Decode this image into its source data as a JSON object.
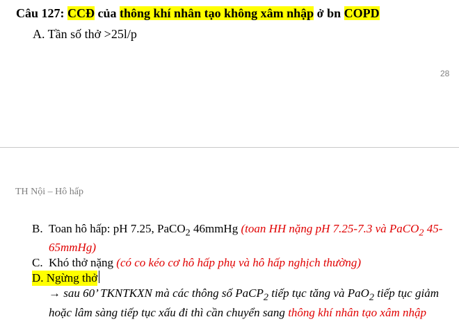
{
  "slide1": {
    "question": {
      "prefix": "Câu 127:",
      "hl1": "CCĐ",
      "mid1": "của",
      "hl2": "thông khí nhân tạo không xâm nhập",
      "mid2": "ở bn",
      "hl3": "COPD"
    },
    "option_a": "A. Tần số thở >25l/p",
    "page_number": "28"
  },
  "slide2": {
    "section_label": "TH Nội – Hô hấp",
    "options": {
      "b": {
        "letter": "B.",
        "text_pre": "Toan hô hấp: pH 7.25, PaCO",
        "sub": "2",
        "text_post": " 46mmHg",
        "note_pre": "(toan HH nặng pH 7.25-7.3 và PaCO",
        "note_sub": "2",
        "note_post": " 45-65mmHg)"
      },
      "c": {
        "letter": "C.",
        "text": "Khó thở nặng",
        "note": "(có co kéo cơ hô hấp phụ và hô hấp nghịch thường)"
      },
      "d": {
        "letter": "D.",
        "text": "Ngừng thở"
      }
    },
    "explanation": {
      "part1": "→ sau 60’ TKNTKXN mà các thông số PaCP",
      "sub1": "2",
      "part2": " tiếp tục tăng và PaO",
      "sub2": "2",
      "part3": " tiếp tục giảm hoặc lâm sàng tiếp tục xấu đi thì cần chuyển sang ",
      "red_text": "thông khí nhân tạo xâm nhập"
    }
  }
}
